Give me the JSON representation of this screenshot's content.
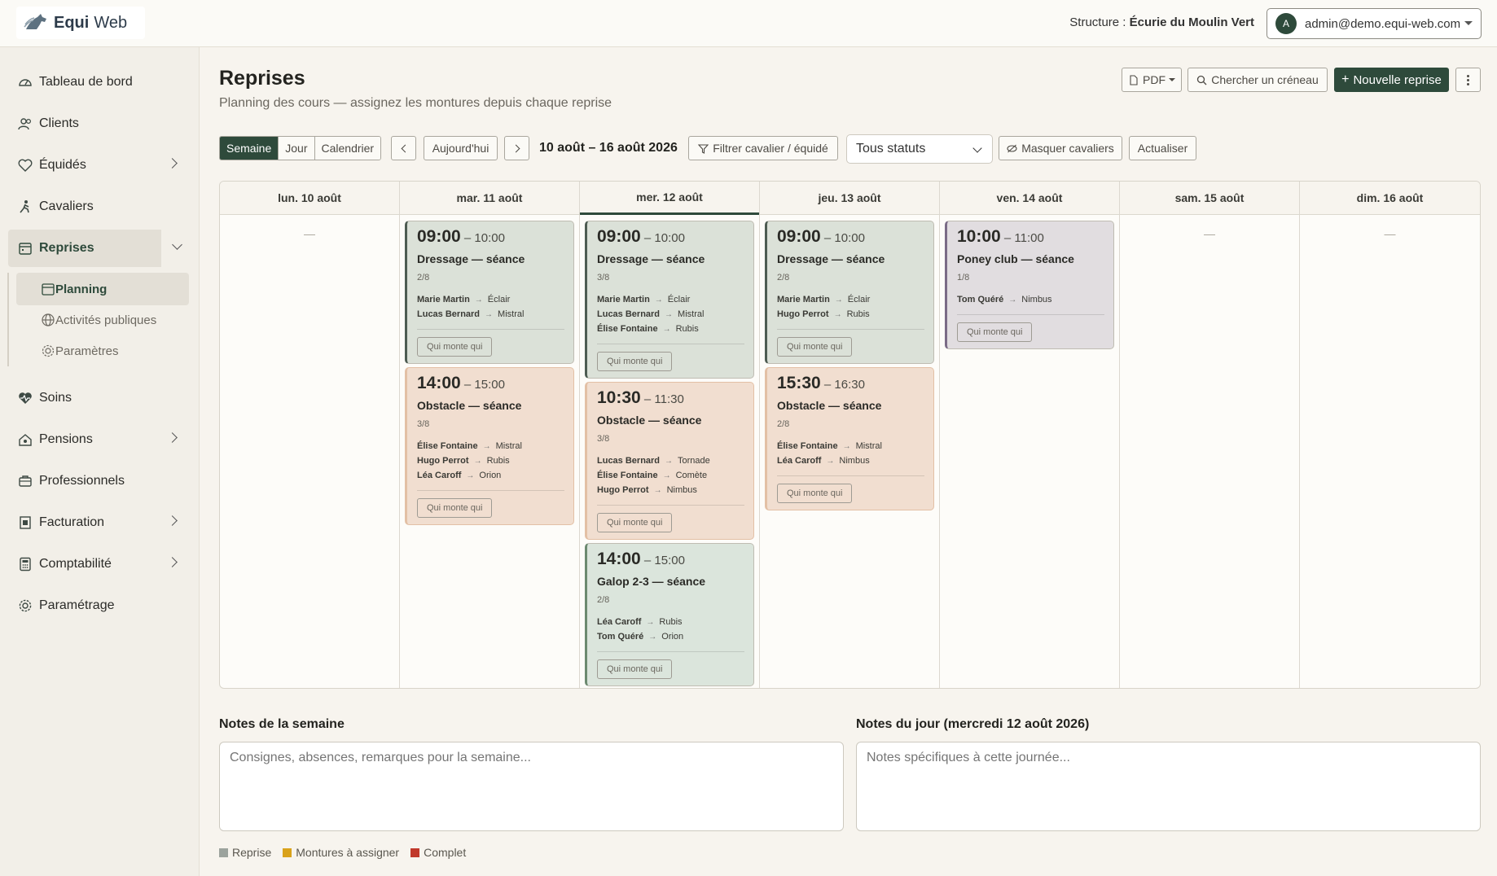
{
  "brand": {
    "name_bold": "Equi",
    "name_light": "Web"
  },
  "header": {
    "structure_label": "Structure : ",
    "structure_name": "Écurie du Moulin Vert",
    "account_initial": "A",
    "account_email": "admin@demo.equi-web.com"
  },
  "sidebar": {
    "items": [
      {
        "label": "Tableau de bord",
        "icon": "dashboard-icon"
      },
      {
        "label": "Clients",
        "icon": "users-icon"
      },
      {
        "label": "Équidés",
        "icon": "horse-heart-icon"
      },
      {
        "label": "Cavaliers",
        "icon": "rider-icon"
      },
      {
        "label": "Reprises",
        "icon": "calendar-icon"
      },
      {
        "label": "Soins",
        "icon": "heart-pulse-icon"
      },
      {
        "label": "Pensions",
        "icon": "house-icon"
      },
      {
        "label": "Professionnels",
        "icon": "briefcase-icon"
      },
      {
        "label": "Facturation",
        "icon": "invoice-icon"
      },
      {
        "label": "Comptabilité",
        "icon": "calculator-icon"
      },
      {
        "label": "Paramétrage",
        "icon": "settings-icon"
      }
    ],
    "subitems": [
      {
        "label": "Planning",
        "icon": "calendar-icon"
      },
      {
        "label": "Activités publiques",
        "icon": "globe-icon"
      },
      {
        "label": "Paramètres",
        "icon": "gear-icon"
      }
    ]
  },
  "page": {
    "title": "Reprises",
    "subtitle": "Planning des cours — assignez les montures depuis chaque reprise",
    "pdf_label": "PDF",
    "search_slot_label": "Chercher un créneau",
    "new_label": "Nouvelle reprise"
  },
  "toolbar": {
    "views": [
      "Semaine",
      "Jour",
      "Calendrier"
    ],
    "today_label": "Aujourd'hui",
    "range": "10 août – 16 août 2026",
    "filter_label": "Filtrer cavalier / équidé",
    "status_value": "Tous statuts",
    "hide_riders_label": "Masquer cavaliers",
    "refresh_label": "Actualiser"
  },
  "calendar": {
    "days": [
      {
        "label": "lun. 10 août",
        "empty": "—"
      },
      {
        "label": "mar. 11 août"
      },
      {
        "label": "mer. 12 août"
      },
      {
        "label": "jeu. 13 août"
      },
      {
        "label": "ven. 14 août"
      },
      {
        "label": "sam. 15 août",
        "empty": "—"
      },
      {
        "label": "dim. 16 août",
        "empty": "—"
      }
    ],
    "button_label": "Qui monte qui",
    "arrow": "→",
    "sessions": [
      {
        "day": 1,
        "start": "09:00",
        "end": "– 10:00",
        "title": "Dressage — séance",
        "count": "2/8",
        "color": "green",
        "riders": [
          {
            "name": "Marie Martin",
            "horse": "Éclair"
          },
          {
            "name": "Lucas Bernard",
            "horse": "Mistral"
          }
        ]
      },
      {
        "day": 1,
        "start": "14:00",
        "end": "– 15:00",
        "title": "Obstacle — séance",
        "count": "3/8",
        "color": "orange",
        "riders": [
          {
            "name": "Élise Fontaine",
            "horse": "Mistral"
          },
          {
            "name": "Hugo Perrot",
            "horse": "Rubis"
          },
          {
            "name": "Léa Caroff",
            "horse": "Orion"
          }
        ]
      },
      {
        "day": 2,
        "start": "09:00",
        "end": "– 10:00",
        "title": "Dressage — séance",
        "count": "3/8",
        "color": "green",
        "riders": [
          {
            "name": "Marie Martin",
            "horse": "Éclair"
          },
          {
            "name": "Lucas Bernard",
            "horse": "Mistral"
          },
          {
            "name": "Élise Fontaine",
            "horse": "Rubis"
          }
        ]
      },
      {
        "day": 2,
        "start": "10:30",
        "end": "– 11:30",
        "title": "Obstacle — séance",
        "count": "3/8",
        "color": "orange",
        "riders": [
          {
            "name": "Lucas Bernard",
            "horse": "Tornade"
          },
          {
            "name": "Élise Fontaine",
            "horse": "Comète"
          },
          {
            "name": "Hugo Perrot",
            "horse": "Nimbus"
          }
        ]
      },
      {
        "day": 2,
        "start": "14:00",
        "end": "– 15:00",
        "title": "Galop 2-3 — séance",
        "count": "2/8",
        "color": "lgreen",
        "riders": [
          {
            "name": "Léa Caroff",
            "horse": "Rubis"
          },
          {
            "name": "Tom Quéré",
            "horse": "Orion"
          }
        ]
      },
      {
        "day": 3,
        "start": "09:00",
        "end": "– 10:00",
        "title": "Dressage — séance",
        "count": "2/8",
        "color": "green",
        "riders": [
          {
            "name": "Marie Martin",
            "horse": "Éclair"
          },
          {
            "name": "Hugo Perrot",
            "horse": "Rubis"
          }
        ]
      },
      {
        "day": 3,
        "start": "15:30",
        "end": "– 16:30",
        "title": "Obstacle — séance",
        "count": "2/8",
        "color": "orange",
        "riders": [
          {
            "name": "Élise Fontaine",
            "horse": "Mistral"
          },
          {
            "name": "Léa Caroff",
            "horse": "Nimbus"
          }
        ]
      },
      {
        "day": 4,
        "start": "10:00",
        "end": "– 11:00",
        "title": "Poney club — séance",
        "count": "1/8",
        "color": "purple",
        "riders": [
          {
            "name": "Tom Quéré",
            "horse": "Nimbus"
          }
        ]
      }
    ]
  },
  "notes": {
    "week_label": "Notes de la semaine",
    "week_placeholder": "Consignes, absences, remarques pour la semaine...",
    "day_label": "Notes du jour (mercredi 12 août 2026)",
    "day_placeholder": "Notes spécifiques à cette journée..."
  },
  "legend": [
    {
      "label": "Reprise",
      "color": "#9ca39d"
    },
    {
      "label": "Montures à assigner",
      "color": "#d9a21b"
    },
    {
      "label": "Complet",
      "color": "#c0392b"
    }
  ],
  "colors": {
    "accent": "#2e4a3b",
    "background": "#f7f4ee"
  }
}
